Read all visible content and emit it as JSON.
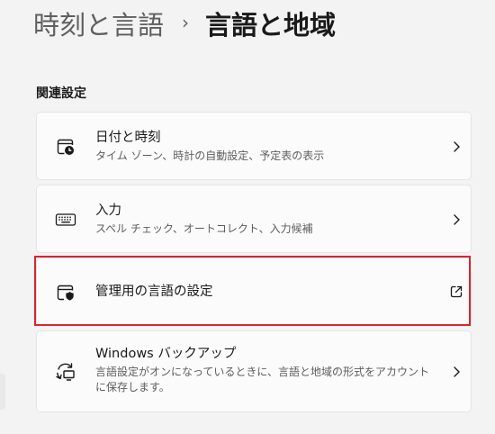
{
  "header": {
    "parent_label": "時刻と言語",
    "separator": "›",
    "current_label": "言語と地域"
  },
  "section": {
    "title": "関連設定"
  },
  "cards": [
    {
      "title": "日付と時刻",
      "subtitle": "タイム ゾーン、時計の自動設定、予定表の表示",
      "icon": "date-time-icon",
      "action_icon": "chevron-right-icon"
    },
    {
      "title": "入力",
      "subtitle": "スペル チェック、オートコレクト、入力候補",
      "icon": "keyboard-icon",
      "action_icon": "chevron-right-icon"
    },
    {
      "title": "管理用の言語の設定",
      "subtitle": "",
      "icon": "admin-shield-icon",
      "action_icon": "external-link-icon",
      "highlighted": true
    },
    {
      "title": "Windows バックアップ",
      "subtitle": "言語設定がオンになっているときに、言語と地域の形式をアカウントに保存します。",
      "icon": "backup-sync-icon",
      "action_icon": "chevron-right-icon"
    }
  ],
  "colors": {
    "background": "#f3f3f3",
    "card": "#fbfbfb",
    "highlight_border": "#d9232f"
  }
}
